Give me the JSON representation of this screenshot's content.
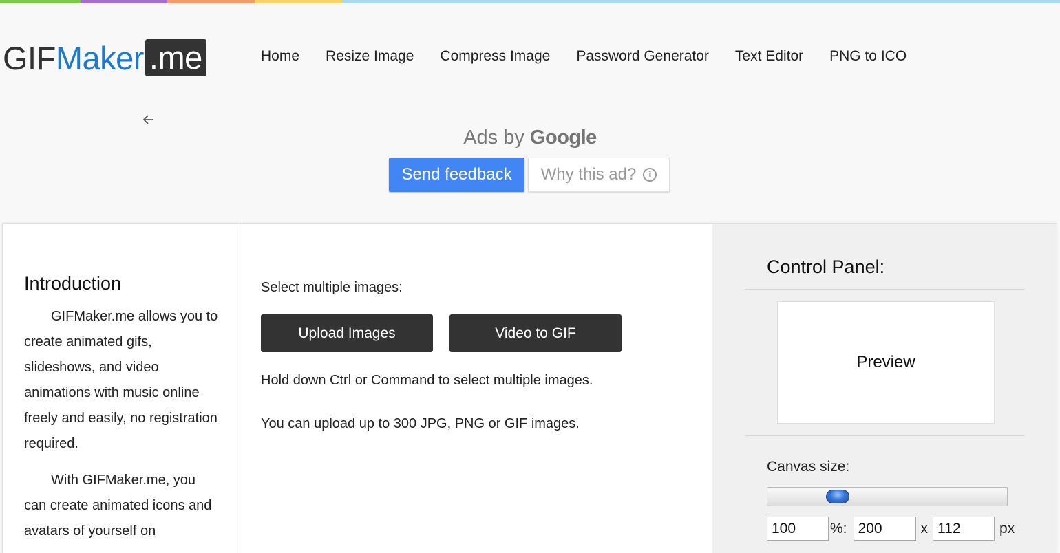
{
  "colorbar": [
    "#7cc74a",
    "#a46fd1",
    "#f59a6a",
    "#f8d36a",
    "#a8d9ee"
  ],
  "logo": {
    "gif": "GIF",
    "maker": "Maker",
    "me": ".me"
  },
  "nav": [
    {
      "label": "Home"
    },
    {
      "label": "Resize Image"
    },
    {
      "label": "Compress Image"
    },
    {
      "label": "Password Generator"
    },
    {
      "label": "Text Editor"
    },
    {
      "label": "PNG to ICO"
    }
  ],
  "ad": {
    "back_icon": "arrow-left-icon",
    "ads_by": "Ads by",
    "google": "Google",
    "send_feedback": "Send feedback",
    "why_ad": "Why this ad?",
    "info_glyph": "i"
  },
  "intro": {
    "title": "Introduction",
    "p1": "GIFMaker.me allows you to create animated gifs, slideshows, and video animations with music online freely and easily, no registration required.",
    "p2": "With GIFMaker.me, you can create animated icons and avatars of yourself on"
  },
  "upload": {
    "label": "Select multiple images:",
    "upload_button": "Upload Images",
    "video_button": "Video to GIF",
    "hint": "Hold down Ctrl or Command to select multiple images.",
    "limit": "You can upload up to 300 JPG, PNG or GIF images."
  },
  "control_panel": {
    "title": "Control Panel:",
    "preview": "Preview",
    "canvas_label": "Canvas size:",
    "slider_fraction": 0.27,
    "percent_value": "100",
    "percent_sep": "%:",
    "width_value": "200",
    "x_sep": "x",
    "height_value": "112",
    "unit": "px"
  }
}
